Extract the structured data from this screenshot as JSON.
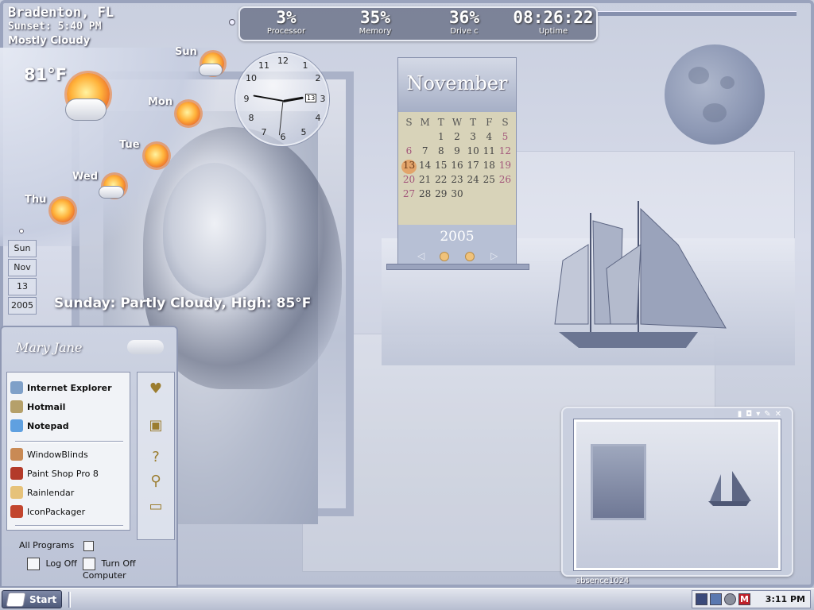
{
  "weather": {
    "location": "Bradenton, FL",
    "sunset": "Sunset: 5:40 PM",
    "condition": "Mostly Cloudy",
    "temperature": "81°F",
    "days": [
      "Sun",
      "Mon",
      "Tue",
      "Wed",
      "Thu"
    ],
    "forecast": "Sunday: Partly Cloudy, High: 85°F"
  },
  "stats": [
    {
      "value": "3%",
      "label": "Processor"
    },
    {
      "value": "35%",
      "label": "Memory"
    },
    {
      "value": "36%",
      "label": "Drive c"
    },
    {
      "value": "08:26:22",
      "label": "Uptime"
    }
  ],
  "clock": {
    "numbers": [
      "12",
      "1",
      "2",
      "3",
      "4",
      "5",
      "6",
      "7",
      "8",
      "9",
      "10",
      "11"
    ],
    "date_badge": "13"
  },
  "date_column": {
    "day": "Sun",
    "month": "Nov",
    "date": "13",
    "year": "2005"
  },
  "calendar": {
    "month": "November",
    "year": "2005",
    "weekdays": [
      "S",
      "M",
      "T",
      "W",
      "T",
      "F",
      "S"
    ],
    "weeks": [
      [
        "",
        "",
        "1",
        "2",
        "3",
        "4",
        "5"
      ],
      [
        "6",
        "7",
        "8",
        "9",
        "10",
        "11",
        "12"
      ],
      [
        "13",
        "14",
        "15",
        "16",
        "17",
        "18",
        "19"
      ],
      [
        "20",
        "21",
        "22",
        "23",
        "24",
        "25",
        "26"
      ],
      [
        "27",
        "28",
        "29",
        "30",
        "",
        "",
        ""
      ]
    ],
    "today": "13"
  },
  "preview": {
    "label": "absence1024"
  },
  "start_menu": {
    "user": "Mary Jane",
    "pinned": [
      "Internet Explorer",
      "Hotmail",
      "Notepad"
    ],
    "recent": [
      "WindowBlinds",
      "Paint Shop Pro 8",
      "Rainlendar",
      "IconPackager"
    ],
    "all_programs": "All Programs",
    "log_off": "Log Off",
    "turn_off": "Turn Off Computer"
  },
  "taskbar": {
    "start": "Start",
    "time": "3:11 PM"
  },
  "colors": {
    "accent": "#4f5a7a",
    "sun": "#ffb23a",
    "calendar_weekend": "#a2557a"
  }
}
